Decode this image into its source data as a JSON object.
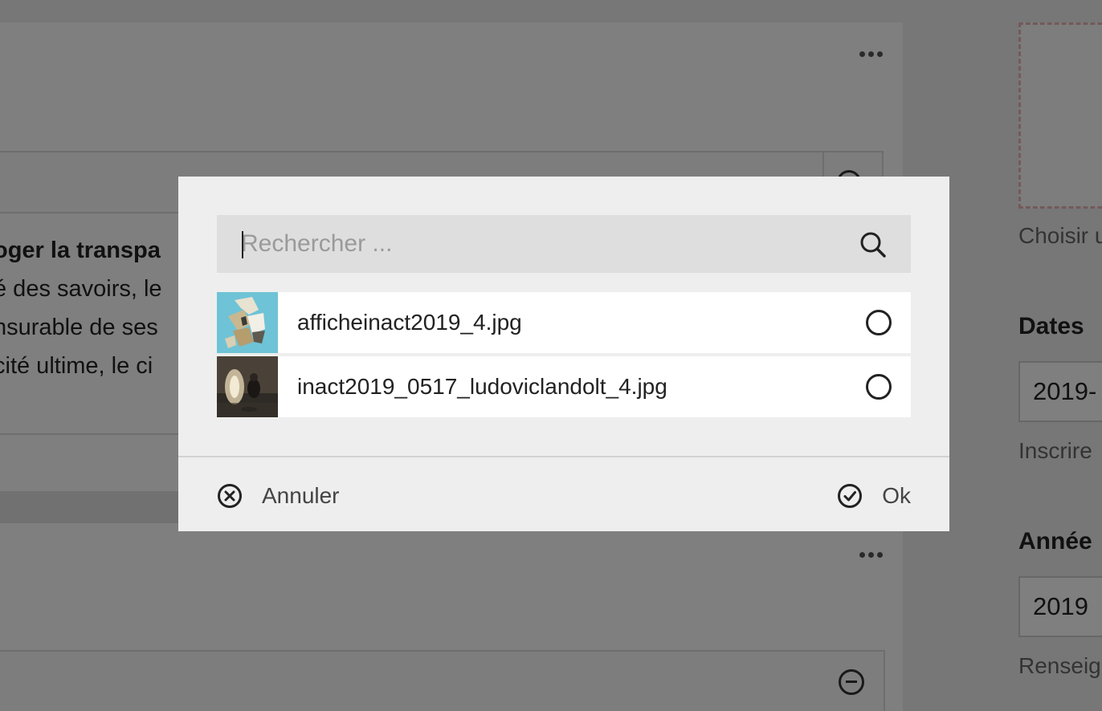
{
  "background": {
    "text_lines": [
      {
        "bold": "oger la transpa",
        "rest": ""
      },
      {
        "bold": "",
        "rest": "é des savoirs, le"
      },
      {
        "bold": "",
        "rest": "nsurable de ses"
      },
      {
        "bold": "",
        "rest": "cité ultime, le ci"
      }
    ],
    "sidebar": {
      "image_hint": "Choisir u",
      "dates_heading": "Dates",
      "dates_value": "2019-",
      "dates_hint": "Inscrire",
      "year_heading": "Année",
      "year_value": "2019",
      "year_hint": "Renseig"
    }
  },
  "dialog": {
    "search_placeholder": "Rechercher ...",
    "search_value": "",
    "files": [
      {
        "name": "afficheinact2019_4.jpg",
        "thumbnail": "poster-collage-thumbnail",
        "selected": false
      },
      {
        "name": "inact2019_0517_ludoviclandolt_4.jpg",
        "thumbnail": "performance-photo-thumbnail",
        "selected": false
      }
    ],
    "cancel_label": "Annuler",
    "ok_label": "Ok"
  },
  "colors": {
    "modal_bg": "#eeeeee",
    "search_bg": "#dedede",
    "overlay": "rgba(0,0,0,0.5)",
    "text": "#222222"
  }
}
